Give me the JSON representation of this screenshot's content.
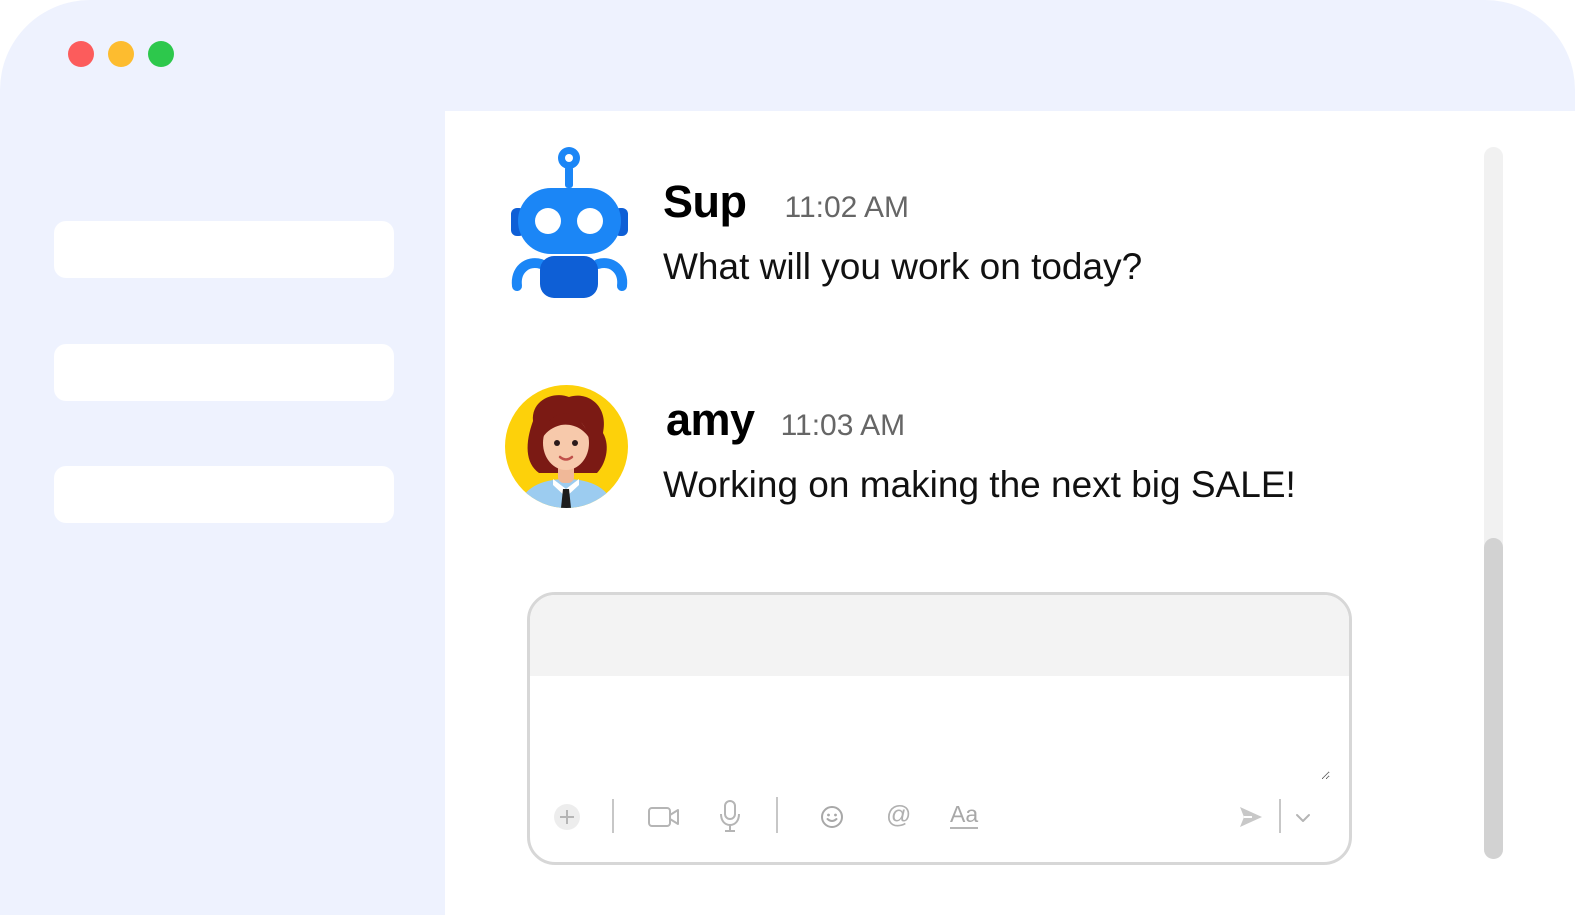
{
  "window": {
    "controls": [
      "close",
      "minimize",
      "maximize"
    ],
    "colors": {
      "background": "#eef2fe",
      "close": "#fc5c5c",
      "minimize": "#fdbc2f",
      "maximize": "#2dc84c"
    }
  },
  "sidebar": {
    "items": [
      {
        "label": ""
      },
      {
        "label": ""
      },
      {
        "label": ""
      }
    ]
  },
  "messages": [
    {
      "author": "Sup",
      "time": "11:02 AM",
      "text": "What will you work on today?",
      "avatar": "robot-icon"
    },
    {
      "author": "amy",
      "time": "11:03 AM",
      "text": "Working on making the next big SALE!",
      "avatar": "woman-avatar"
    }
  ],
  "composer": {
    "value": "",
    "placeholder": "",
    "toolbar": [
      "plus-icon",
      "video-icon",
      "microphone-icon",
      "emoji-icon",
      "mention-icon",
      "text-format-icon",
      "send-icon",
      "chevron-down-icon"
    ],
    "mention_glyph": "@",
    "format_glyph": "Aa"
  }
}
